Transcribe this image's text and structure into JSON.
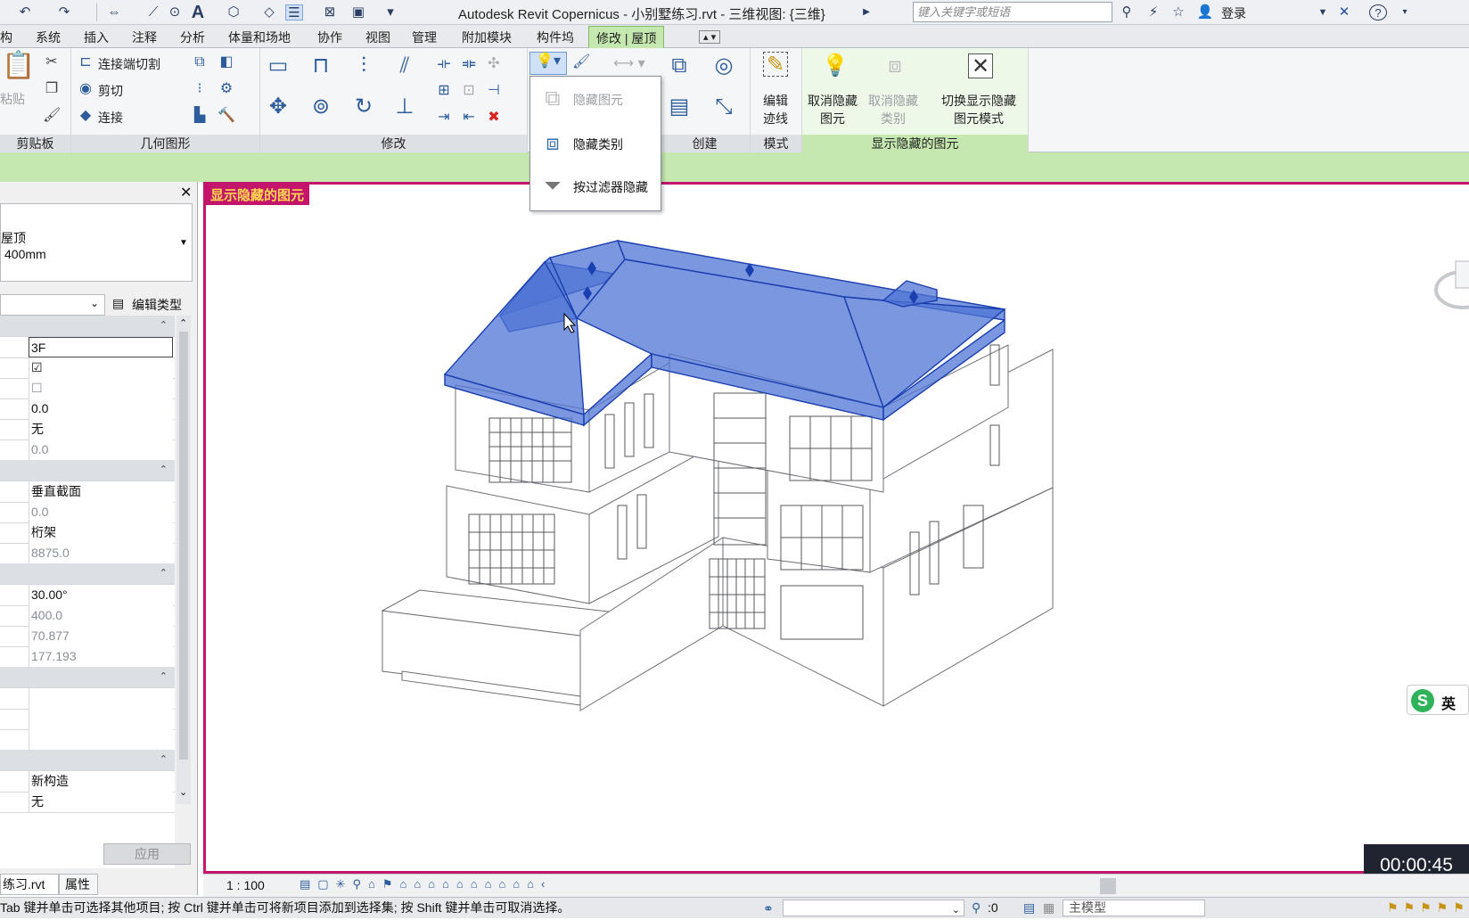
{
  "titlebar": {
    "title": "Autodesk Revit Copernicus -    小别墅练习.rvt - 三维视图: {三维}",
    "search_placeholder": "键入关键字或短语",
    "login": "登录"
  },
  "tabs": [
    "构",
    "系统",
    "插入",
    "注释",
    "分析",
    "体量和场地",
    "协作",
    "视图",
    "管理",
    "附加模块",
    "构件坞"
  ],
  "active_tab": "修改 | 屋顶",
  "ribbon": {
    "clipboard": {
      "paste": "粘贴",
      "label": "剪贴板"
    },
    "geometry": {
      "join_cut": "连接端切割",
      "cut": "剪切",
      "join": "连接",
      "label": "几何图形"
    },
    "modify": {
      "label": "修改"
    },
    "create": {
      "label": "创建"
    },
    "mode": {
      "edit_boundary_1": "编辑",
      "edit_boundary_2": "迹线",
      "label": "模式"
    },
    "reveal": {
      "unhide_element_1": "取消隐藏",
      "unhide_element_2": "图元",
      "unhide_category_1": "取消隐藏",
      "unhide_category_2": "类别",
      "toggle_1": "切换显示隐藏",
      "toggle_2": "图元模式",
      "label": "显示隐藏的图元"
    }
  },
  "dropdown": {
    "items": [
      "隐藏图元",
      "隐藏类别",
      "按过滤器隐藏"
    ]
  },
  "properties": {
    "type_line1": "屋顶",
    "type_line2": "400mm",
    "edit_type": "编辑类型",
    "values": [
      "3F",
      "",
      "",
      "0.0",
      "无",
      "0.0",
      "垂直截面",
      "0.0",
      "桁架",
      "8875.0",
      "30.00°",
      "400.0",
      "70.877",
      "177.193",
      "",
      "",
      "",
      "新构造",
      "无"
    ],
    "apply": "应用",
    "tab_project": "练习.rvt",
    "tab_props": "属性"
  },
  "view": {
    "label": "显示隐藏的图元",
    "scale": "1 : 100",
    "timer": "00:00:45",
    "ime": "英"
  },
  "status": {
    "hint": "Tab 键并单击可选择其他项目; 按 Ctrl 键并单击可将新项目添加到选择集; 按 Shift 键并单击可取消选择。",
    "count": ":0",
    "model": "主模型"
  },
  "colors": {
    "roof_fill": "#4f74d4",
    "highlight_border": "#c2156b",
    "context_tab": "#c5e8b0"
  }
}
